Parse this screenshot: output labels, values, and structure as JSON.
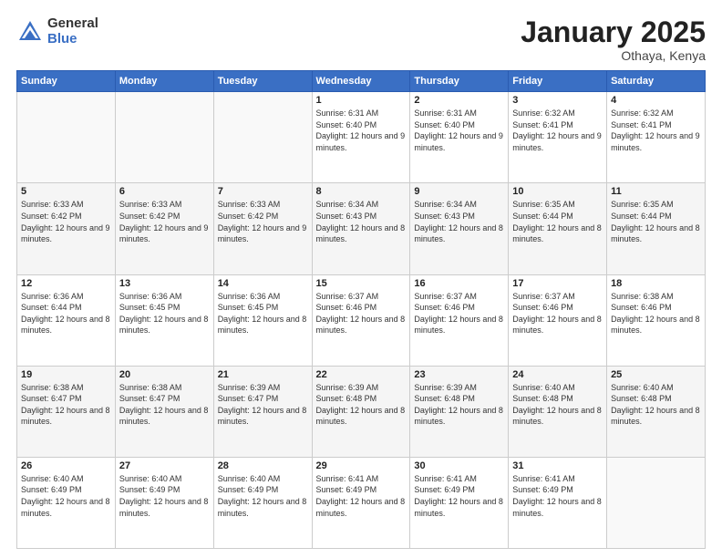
{
  "logo": {
    "general": "General",
    "blue": "Blue"
  },
  "title": "January 2025",
  "location": "Othaya, Kenya",
  "days_header": [
    "Sunday",
    "Monday",
    "Tuesday",
    "Wednesday",
    "Thursday",
    "Friday",
    "Saturday"
  ],
  "weeks": [
    [
      {
        "day": "",
        "info": ""
      },
      {
        "day": "",
        "info": ""
      },
      {
        "day": "",
        "info": ""
      },
      {
        "day": "1",
        "info": "Sunrise: 6:31 AM\nSunset: 6:40 PM\nDaylight: 12 hours and 9 minutes."
      },
      {
        "day": "2",
        "info": "Sunrise: 6:31 AM\nSunset: 6:40 PM\nDaylight: 12 hours and 9 minutes."
      },
      {
        "day": "3",
        "info": "Sunrise: 6:32 AM\nSunset: 6:41 PM\nDaylight: 12 hours and 9 minutes."
      },
      {
        "day": "4",
        "info": "Sunrise: 6:32 AM\nSunset: 6:41 PM\nDaylight: 12 hours and 9 minutes."
      }
    ],
    [
      {
        "day": "5",
        "info": "Sunrise: 6:33 AM\nSunset: 6:42 PM\nDaylight: 12 hours and 9 minutes."
      },
      {
        "day": "6",
        "info": "Sunrise: 6:33 AM\nSunset: 6:42 PM\nDaylight: 12 hours and 9 minutes."
      },
      {
        "day": "7",
        "info": "Sunrise: 6:33 AM\nSunset: 6:42 PM\nDaylight: 12 hours and 9 minutes."
      },
      {
        "day": "8",
        "info": "Sunrise: 6:34 AM\nSunset: 6:43 PM\nDaylight: 12 hours and 8 minutes."
      },
      {
        "day": "9",
        "info": "Sunrise: 6:34 AM\nSunset: 6:43 PM\nDaylight: 12 hours and 8 minutes."
      },
      {
        "day": "10",
        "info": "Sunrise: 6:35 AM\nSunset: 6:44 PM\nDaylight: 12 hours and 8 minutes."
      },
      {
        "day": "11",
        "info": "Sunrise: 6:35 AM\nSunset: 6:44 PM\nDaylight: 12 hours and 8 minutes."
      }
    ],
    [
      {
        "day": "12",
        "info": "Sunrise: 6:36 AM\nSunset: 6:44 PM\nDaylight: 12 hours and 8 minutes."
      },
      {
        "day": "13",
        "info": "Sunrise: 6:36 AM\nSunset: 6:45 PM\nDaylight: 12 hours and 8 minutes."
      },
      {
        "day": "14",
        "info": "Sunrise: 6:36 AM\nSunset: 6:45 PM\nDaylight: 12 hours and 8 minutes."
      },
      {
        "day": "15",
        "info": "Sunrise: 6:37 AM\nSunset: 6:46 PM\nDaylight: 12 hours and 8 minutes."
      },
      {
        "day": "16",
        "info": "Sunrise: 6:37 AM\nSunset: 6:46 PM\nDaylight: 12 hours and 8 minutes."
      },
      {
        "day": "17",
        "info": "Sunrise: 6:37 AM\nSunset: 6:46 PM\nDaylight: 12 hours and 8 minutes."
      },
      {
        "day": "18",
        "info": "Sunrise: 6:38 AM\nSunset: 6:46 PM\nDaylight: 12 hours and 8 minutes."
      }
    ],
    [
      {
        "day": "19",
        "info": "Sunrise: 6:38 AM\nSunset: 6:47 PM\nDaylight: 12 hours and 8 minutes."
      },
      {
        "day": "20",
        "info": "Sunrise: 6:38 AM\nSunset: 6:47 PM\nDaylight: 12 hours and 8 minutes."
      },
      {
        "day": "21",
        "info": "Sunrise: 6:39 AM\nSunset: 6:47 PM\nDaylight: 12 hours and 8 minutes."
      },
      {
        "day": "22",
        "info": "Sunrise: 6:39 AM\nSunset: 6:48 PM\nDaylight: 12 hours and 8 minutes."
      },
      {
        "day": "23",
        "info": "Sunrise: 6:39 AM\nSunset: 6:48 PM\nDaylight: 12 hours and 8 minutes."
      },
      {
        "day": "24",
        "info": "Sunrise: 6:40 AM\nSunset: 6:48 PM\nDaylight: 12 hours and 8 minutes."
      },
      {
        "day": "25",
        "info": "Sunrise: 6:40 AM\nSunset: 6:48 PM\nDaylight: 12 hours and 8 minutes."
      }
    ],
    [
      {
        "day": "26",
        "info": "Sunrise: 6:40 AM\nSunset: 6:49 PM\nDaylight: 12 hours and 8 minutes."
      },
      {
        "day": "27",
        "info": "Sunrise: 6:40 AM\nSunset: 6:49 PM\nDaylight: 12 hours and 8 minutes."
      },
      {
        "day": "28",
        "info": "Sunrise: 6:40 AM\nSunset: 6:49 PM\nDaylight: 12 hours and 8 minutes."
      },
      {
        "day": "29",
        "info": "Sunrise: 6:41 AM\nSunset: 6:49 PM\nDaylight: 12 hours and 8 minutes."
      },
      {
        "day": "30",
        "info": "Sunrise: 6:41 AM\nSunset: 6:49 PM\nDaylight: 12 hours and 8 minutes."
      },
      {
        "day": "31",
        "info": "Sunrise: 6:41 AM\nSunset: 6:49 PM\nDaylight: 12 hours and 8 minutes."
      },
      {
        "day": "",
        "info": ""
      }
    ]
  ]
}
